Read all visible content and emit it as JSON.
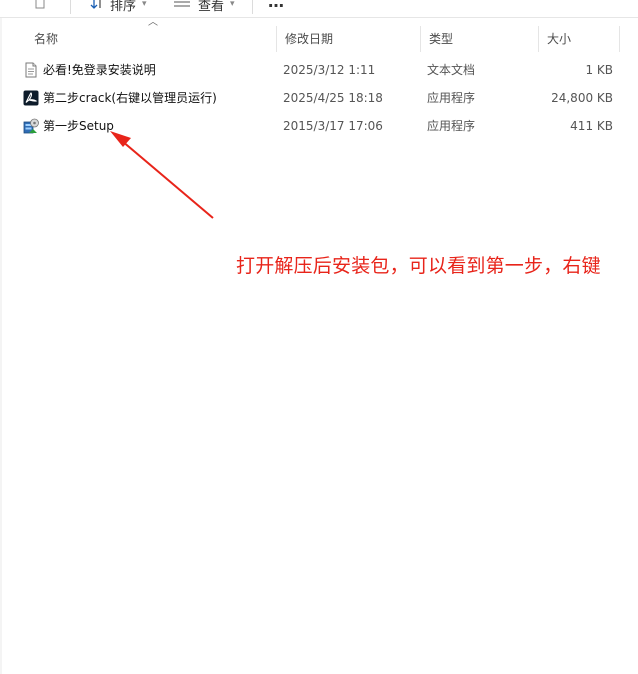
{
  "toolbar": {
    "sort_label": "排序",
    "view_label": "查看",
    "more_label": "…"
  },
  "columns": {
    "name": "名称",
    "date": "修改日期",
    "type": "类型",
    "size": "大小"
  },
  "files": [
    {
      "name": "必看!免登录安装说明",
      "date": "2025/3/12 1:11",
      "type": "文本文档",
      "size": "1 KB",
      "icon": "text-document-icon"
    },
    {
      "name": "第二步crack(右键以管理员运行)",
      "date": "2025/4/25 18:18",
      "type": "应用程序",
      "size": "24,800 KB",
      "icon": "adobe-acrobat-icon"
    },
    {
      "name": "第一步Setup",
      "date": "2015/3/17 17:06",
      "type": "应用程序",
      "size": "411 KB",
      "icon": "setup-installer-icon"
    }
  ],
  "annotation": {
    "text": "打开解压后安装包，可以看到第一步，右键",
    "color": "#e8241a"
  }
}
